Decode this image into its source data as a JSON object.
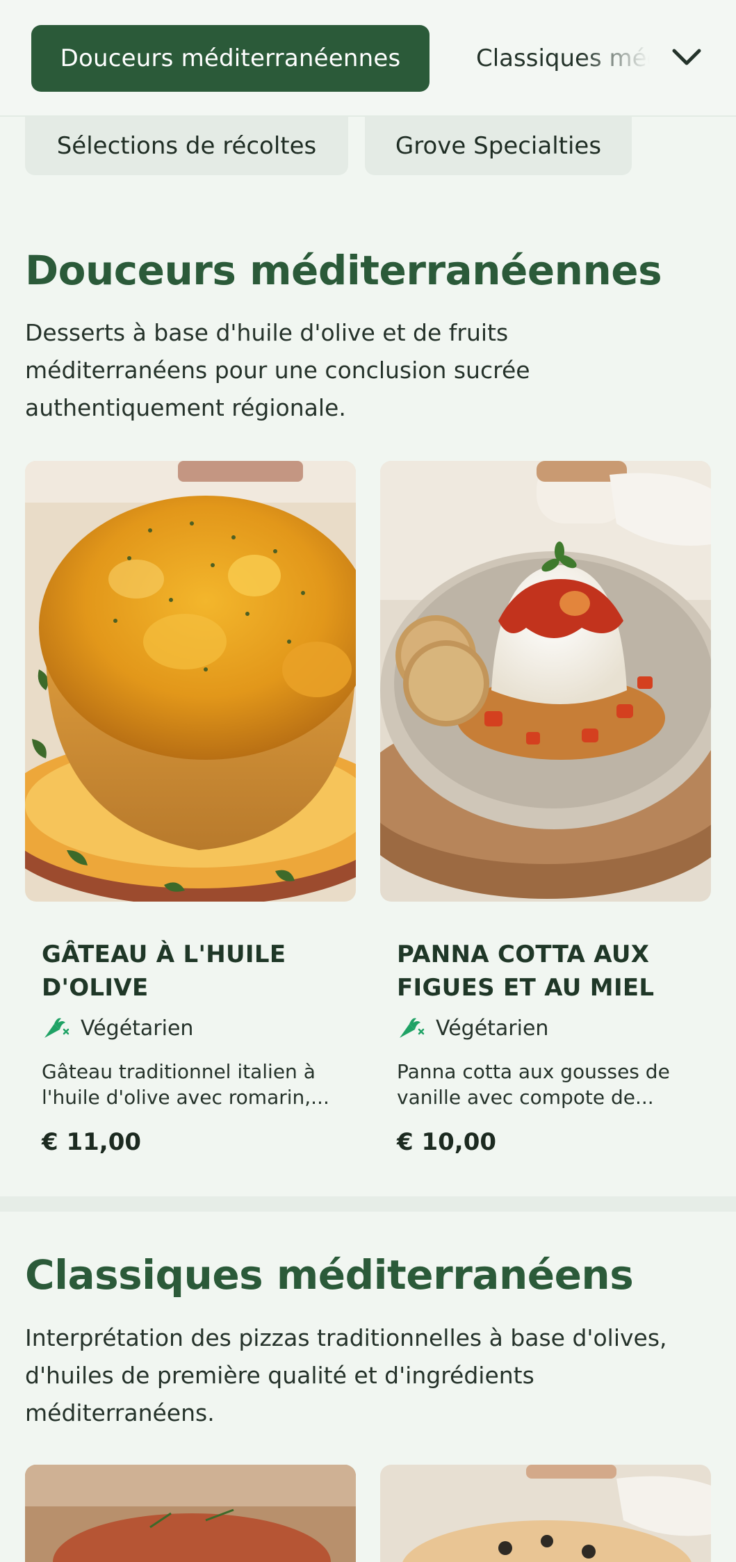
{
  "categories": {
    "active": "Douceurs méditerranéennes",
    "next": "Classiques méditerranéens",
    "row2": [
      "Sélections de récoltes",
      "Grove Specialties"
    ]
  },
  "sections": [
    {
      "title": "Douceurs méditerranéennes",
      "description": "Desserts à base d'huile d'olive et de fruits méditerranéens pour une conclusion sucrée authentiquement régionale.",
      "items": [
        {
          "name": "GÂTEAU À L'HUILE D'OLIVE",
          "tag": "Végétarien",
          "description": "Gâteau traditionnel italien à l'huile d'olive avec romarin,...",
          "price": "€ 11,00"
        },
        {
          "name": "PANNA COTTA AUX FIGUES ET AU MIEL",
          "tag": "Végétarien",
          "description": "Panna cotta aux gousses de vanille avec compote de...",
          "price": "€ 10,00"
        }
      ]
    },
    {
      "title": "Classiques méditerranéens",
      "description": "Interprétation des pizzas traditionnelles à base d'olives, d'huiles de première qualité et d'ingrédients méditerranéens."
    }
  ],
  "icons": {
    "dropdown": "chevron-down-icon",
    "vegetarian": "carrot-icon"
  },
  "colors": {
    "accent": "#2b5a39",
    "background": "#f1f6f1",
    "veg_icon": "#1fa265"
  }
}
